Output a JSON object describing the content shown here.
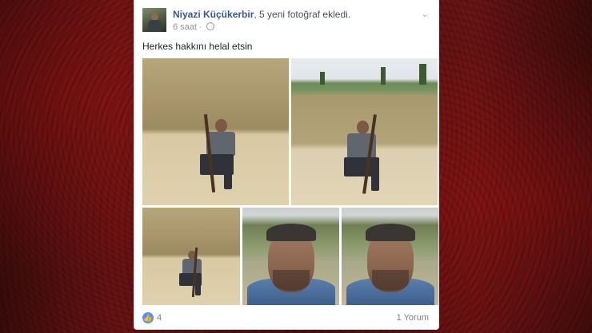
{
  "post": {
    "author": "Niyazi Küçükerbir",
    "action": ", 5 yeni fotoğraf ekledi.",
    "time": "6 saat ·",
    "text": "Herkes hakkını helal etsin",
    "photos": [
      {
        "scene": "quarry-kneeling-with-rifle"
      },
      {
        "scene": "quarry-trees-kneeling-with-rifle"
      },
      {
        "scene": "quarry-small-kneeling"
      },
      {
        "scene": "selfie-man-blue-shirt"
      },
      {
        "scene": "selfie-man-blue-shirt"
      }
    ],
    "reactions": {
      "icon": "like-icon",
      "count": "4"
    },
    "comments_label": "1 Yorum"
  },
  "colors": {
    "author_link": "#365899",
    "meta": "#90949c",
    "like_blue": "#5890ff",
    "background_red": "#6b1414"
  }
}
